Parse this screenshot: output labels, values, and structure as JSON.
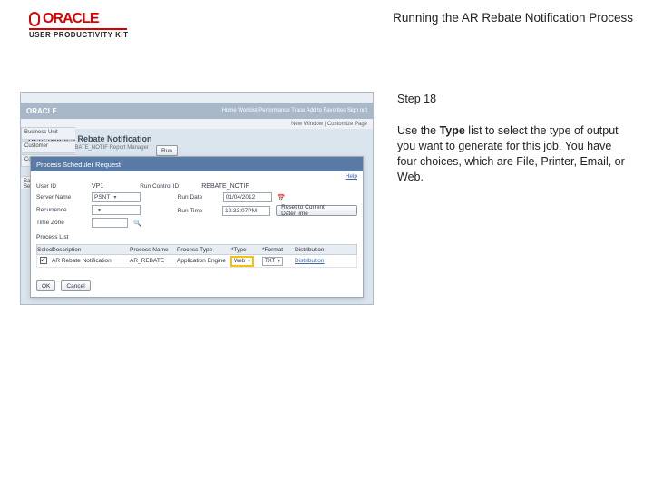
{
  "header": {
    "logo_word": "ORACLE",
    "logo_sub": "USER PRODUCTIVITY KIT",
    "doc_title": "Running the AR Rebate Notification Process"
  },
  "instruction": {
    "step_label": "Step 18",
    "body_pre": "Use the ",
    "body_bold": "Type",
    "body_post": " list to select the type of output you want to generate for this job. You have four choices, which are File, Printer, Email, or Web."
  },
  "screenshot": {
    "brand": "ORACLE",
    "brand_right": "Home   Worklist   Performance Trace   Add to Favorites   Sign out",
    "crumb": "New Window | Customize Page",
    "page_title": "Receivables Rebate Notification",
    "sub_runctl": "Run Control ID: REBATE_NOTIF   Report Manager",
    "modal": {
      "title": "Process Scheduler Request",
      "help": "Help",
      "userid_lbl": "User ID",
      "userid_val": "VP1",
      "runctl_lbl": "Run Control ID",
      "runctl_val": "REBATE_NOTIF",
      "server_lbl": "Server Name",
      "server_val": "PSNT",
      "rundate_lbl": "Run Date",
      "rundate_val": "01/04/2012",
      "recur_lbl": "Recurrence",
      "recur_val": "",
      "runtime_lbl": "Run Time",
      "runtime_val": "12:33:07PM",
      "reset_btn": "Reset to Current Date/Time",
      "tz_lbl": "Time Zone",
      "plist_label": "Process List",
      "cols": {
        "select": "Select",
        "desc": "Description",
        "pname": "Process Name",
        "ptype": "Process Type",
        "type": "*Type",
        "format": "*Format",
        "dist": "Distribution"
      },
      "row": {
        "desc": "AR Rebate Notification",
        "pname": "AR_REBATE",
        "ptype": "Application Engine",
        "type": "Web",
        "format": "TXT",
        "dist": "Distribution"
      },
      "ok": "OK",
      "cancel": "Cancel"
    },
    "tabs": {
      "t1": "Business Unit",
      "t2": "Customer",
      "t3": "Contract"
    },
    "runlink": "Save   Return to Search"
  }
}
